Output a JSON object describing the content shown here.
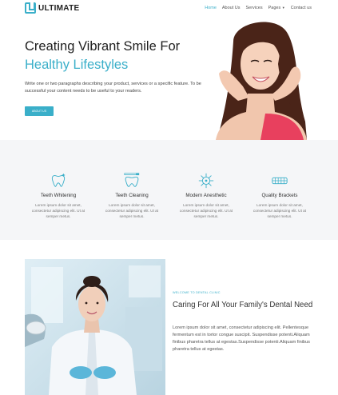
{
  "brand": {
    "name": "ULTIMATE",
    "accent_color": "#3aafc9",
    "logo_icon": "u-logo-icon"
  },
  "nav": {
    "items": [
      {
        "label": "Home",
        "active": true
      },
      {
        "label": "About Us",
        "active": false
      },
      {
        "label": "Services",
        "active": false
      },
      {
        "label": "Pages",
        "active": false,
        "has_dropdown": true
      },
      {
        "label": "Contact us",
        "active": false
      }
    ],
    "dropdown_icon": "caret-down-icon"
  },
  "hero": {
    "title_line1": "Creating Vibrant Smile For",
    "title_line2": "Healthy Lifestyles",
    "text": "Write one or two paragraphs describing your product, services or a specific feature. To be successful your content needs to be useful to your readers.",
    "button_label": "ABOUT US",
    "photo": "smiling-woman-photo"
  },
  "features": [
    {
      "title": "Teeth Whitening",
      "text": "Lorem ipsum dolor sit amet, consectetur adipiscing elit. Ut at semper metus.",
      "icon": "tooth-sparkle-icon"
    },
    {
      "title": "Teeth Cleaning",
      "text": "Lorem ipsum dolor sit amet, consectetur adipiscing elit. Ut at semper metus.",
      "icon": "tooth-brush-icon"
    },
    {
      "title": "Modern Anesthetic",
      "text": "Lorem ipsum dolor sit amet, consectetur adipiscing elit. Ut at semper metus.",
      "icon": "virus-molecule-icon"
    },
    {
      "title": "Quality Brackets",
      "text": "Lorem ipsum dolor sit amet, consectetur adipiscing elit. Ut at semper metus.",
      "icon": "dental-brackets-icon"
    }
  ],
  "about": {
    "kicker": "WELCOME TO DENTAL CLINIC",
    "title": "Caring For All Your Family's Dental Need",
    "text": "Lorem ipsum dolor sit amet, consectetur adipiscing elit. Pellentesque fermentum est in tortor congue suscipit. Suspendisse potenti.Aliquam finibus pharetra tellus at egestas.Suspendisse potenti.Aliquam finibus pharetra tellus at egestas.",
    "photo": "dentist-photo"
  }
}
